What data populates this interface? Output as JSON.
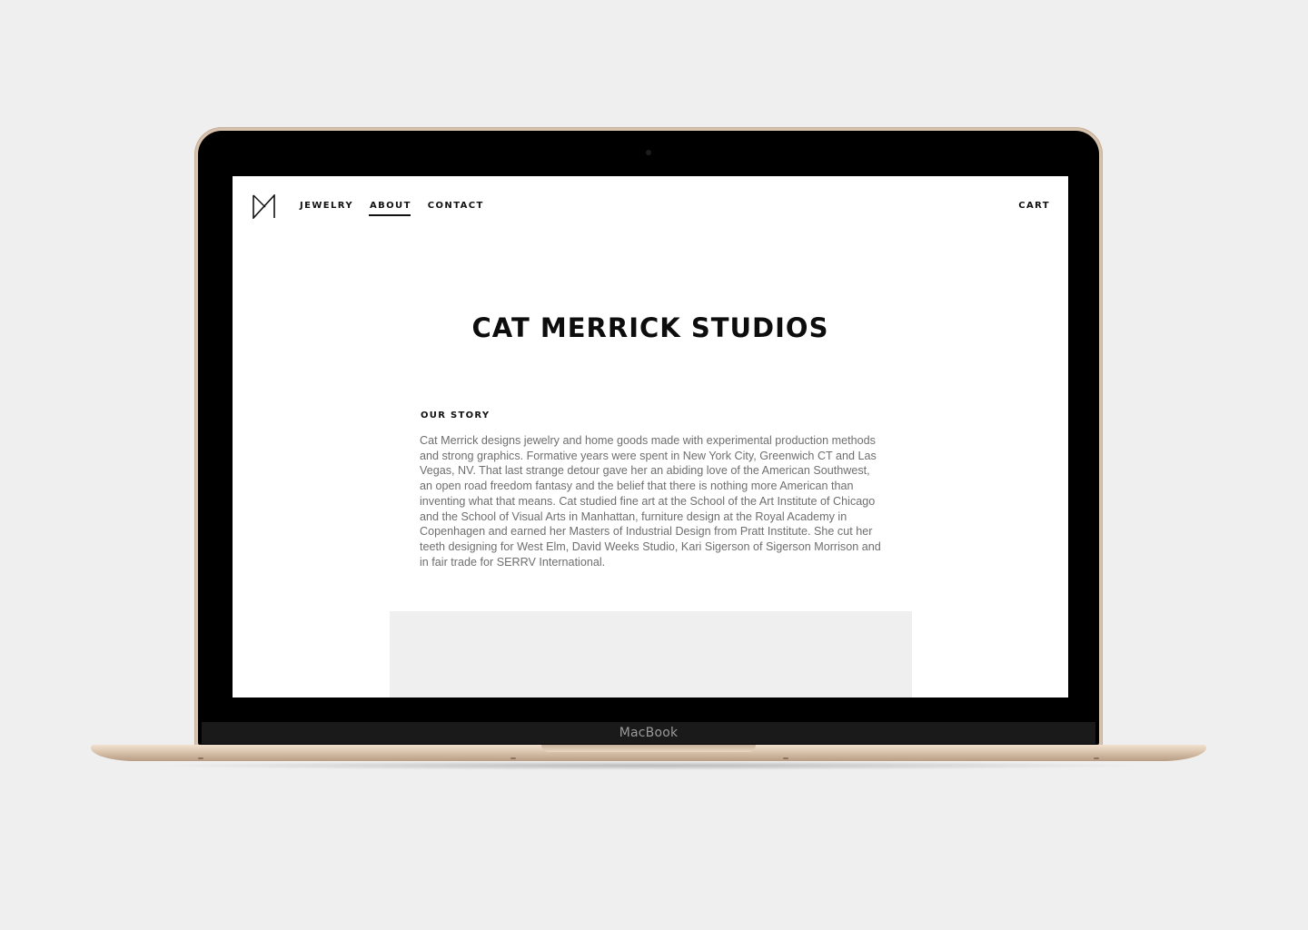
{
  "device": {
    "brand_label": "MacBook"
  },
  "site": {
    "logo_icon": "cm-monogram-icon",
    "nav": {
      "items": [
        {
          "label": "JEWELRY",
          "active": false
        },
        {
          "label": "ABOUT",
          "active": true
        },
        {
          "label": "CONTACT",
          "active": false
        }
      ],
      "cart_label": "CART"
    },
    "page_title": "CAT MERRICK STUDIOS",
    "story": {
      "heading": "OUR STORY",
      "body": "Cat Merrick designs jewelry and home goods made with experimental production methods and strong graphics. Formative years were spent in New York City, Greenwich CT and Las Vegas, NV. That last strange detour gave her an abiding love of the American Southwest, an open road freedom fantasy and the belief that there is nothing more American than inventing what that means. Cat studied fine art at the School of the Art Institute of Chicago and the School of Visual Arts in Manhattan, furniture design at the Royal Academy in Copenhagen and earned her Masters of Industrial Design from Pratt Institute. She cut her teeth designing for West Elm, David Weeks Studio, Kari Sigerson of Sigerson Morrison and in fair trade for SERRV International."
    }
  },
  "colors": {
    "background": "#efefef",
    "laptop_gold": "#d6c2ad",
    "text_primary": "#111111",
    "text_body": "#6e6e6e",
    "placeholder": "#efefef"
  }
}
